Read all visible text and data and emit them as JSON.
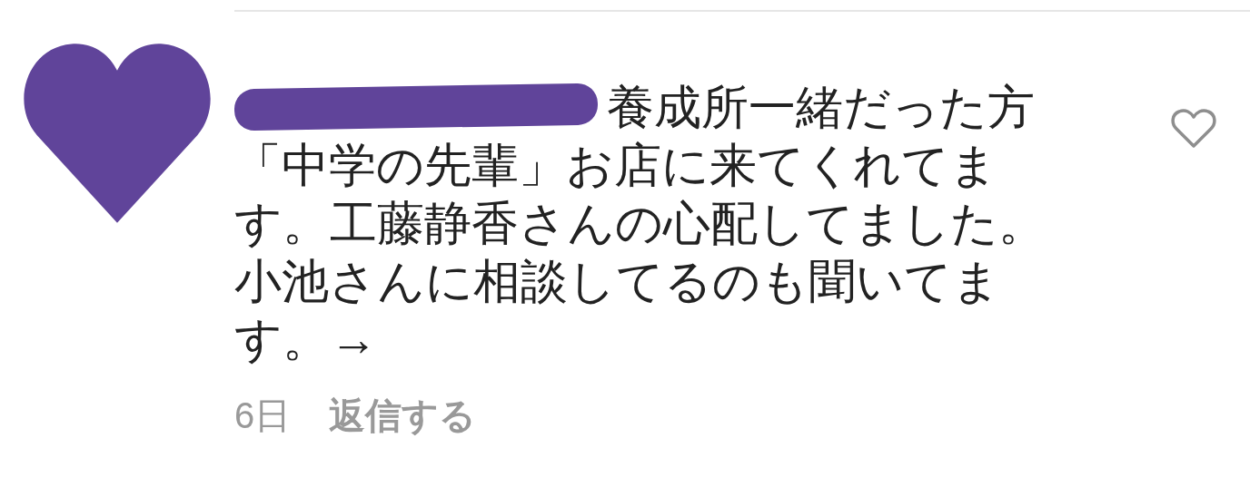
{
  "comment": {
    "lines": [
      "養成所一緒だった方",
      "「中学の先輩」お店に来てくれてま",
      "す。工藤静香さんの心配してました。",
      "小池さんに相談してるのも聞いてま",
      "す。→"
    ],
    "liked": false,
    "time": "6日",
    "reply": "返信する"
  }
}
